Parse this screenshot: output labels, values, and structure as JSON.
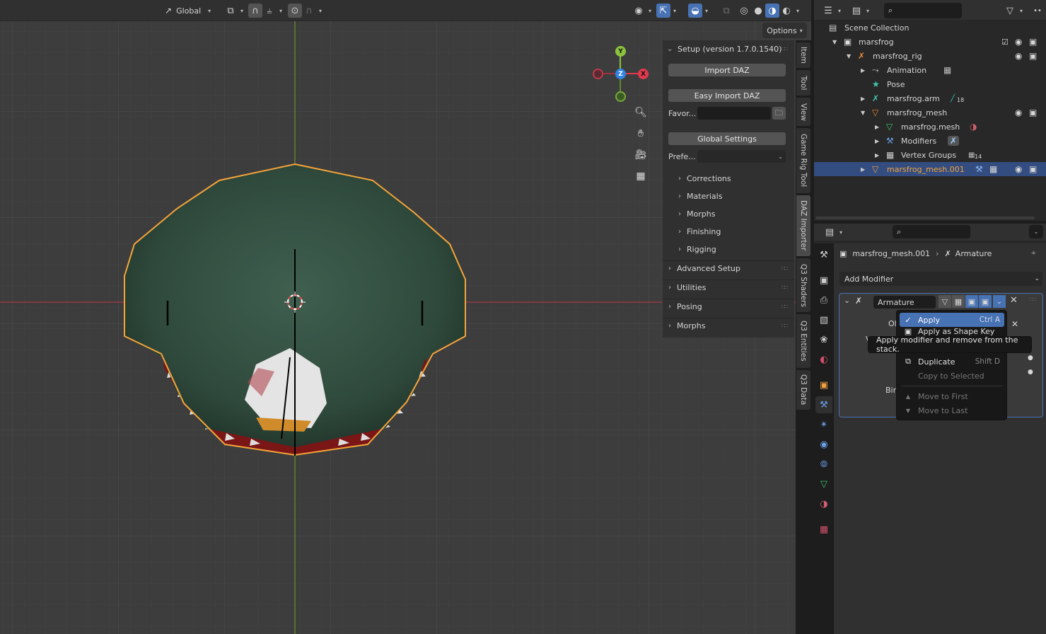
{
  "viewport": {
    "transform_orientation": "Global",
    "options_label": "Options",
    "gizmo": {
      "y": "Y",
      "z": "Z",
      "x": "X"
    }
  },
  "npanel": {
    "setup_header": "Setup (version 1.7.0.1540)",
    "import_daz": "Import DAZ",
    "easy_import_daz": "Easy Import DAZ",
    "favorites_label": "Favor...",
    "global_settings": "Global Settings",
    "preferences_label": "Prefe...",
    "subsections": [
      "Corrections",
      "Materials",
      "Morphs",
      "Finishing",
      "Rigging"
    ],
    "panels": [
      "Advanced Setup",
      "Utilities",
      "Posing",
      "Morphs"
    ]
  },
  "vertical_tabs": [
    "Item",
    "Tool",
    "View",
    "Game Rig Tool",
    "DAZ Importer",
    "Q3 Shaders",
    "Q3 Entities",
    "Q3 Data"
  ],
  "outliner": {
    "search_placeholder": "",
    "rows": [
      {
        "label": "Scene Collection"
      },
      {
        "label": "marsfrog"
      },
      {
        "label": "marsfrog_rig"
      },
      {
        "label": "Animation"
      },
      {
        "label": "Pose"
      },
      {
        "label": "marsfrog.arm",
        "badge": "18"
      },
      {
        "label": "marsfrog_mesh"
      },
      {
        "label": "marsfrog.mesh"
      },
      {
        "label": "Modifiers"
      },
      {
        "label": "Vertex Groups",
        "badge": "14"
      },
      {
        "label": "marsfrog_mesh.001"
      }
    ]
  },
  "properties": {
    "breadcrumb_object": "marsfrog_mesh.001",
    "breadcrumb_modifier": "Armature",
    "add_modifier": "Add Modifier",
    "modifier_name": "Armature",
    "partial_labels": {
      "object": "Ol",
      "vertex": "V",
      "bind": "Bir"
    }
  },
  "context_menu": {
    "items": [
      {
        "label": "Apply",
        "shortcut": "Ctrl A"
      },
      {
        "label": "Apply as Shape Key",
        "shortcut": ""
      },
      {
        "label": "Duplicate",
        "shortcut": "Shift D"
      },
      {
        "label": "Copy to Selected",
        "shortcut": ""
      },
      {
        "label": "Move to First",
        "shortcut": ""
      },
      {
        "label": "Move to Last",
        "shortcut": ""
      }
    ],
    "tooltip": "Apply modifier and remove from the stack."
  },
  "colors": {
    "accent_blue": "#4772b3",
    "selection_orange": "#f5a43a",
    "axis_x": "#e2394f",
    "axis_y": "#8bc43c",
    "axis_z": "#2f84e3"
  }
}
